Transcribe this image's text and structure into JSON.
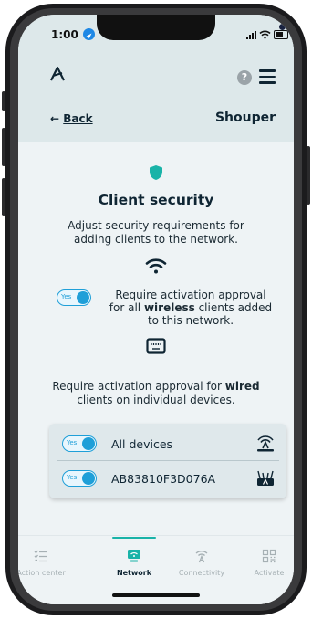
{
  "status_bar": {
    "time": "1:00"
  },
  "header": {
    "back_label": "Back",
    "back_arrow": "←",
    "title": "Shouper",
    "help_glyph": "?"
  },
  "main": {
    "heading": "Client security",
    "description": "Adjust security requirements for adding clients to the network.",
    "wireless": {
      "toggle_label": "Yes",
      "text_before": "Require activation approval for all ",
      "text_bold": "wireless",
      "text_after": " clients added to this network."
    },
    "wired": {
      "text_before": "Require activation approval for ",
      "text_bold": "wired",
      "text_after": " clients on individual devices."
    },
    "devices": [
      {
        "toggle_label": "Yes",
        "label": "All devices",
        "icon": "router-icon"
      },
      {
        "toggle_label": "Yes",
        "label": "AB83810F3D076A",
        "icon": "gateway-icon"
      }
    ]
  },
  "tabs": [
    {
      "label": "Action center",
      "icon": "checklist-icon"
    },
    {
      "label": "Network",
      "icon": "network-icon",
      "active": true
    },
    {
      "label": "Connectivity",
      "icon": "connectivity-icon"
    },
    {
      "label": "Activate",
      "icon": "qr-icon"
    }
  ],
  "colors": {
    "accent": "#19b3a8",
    "toggle": "#1f9fd8",
    "text": "#0f2533",
    "header_bg": "#dde8ea"
  }
}
